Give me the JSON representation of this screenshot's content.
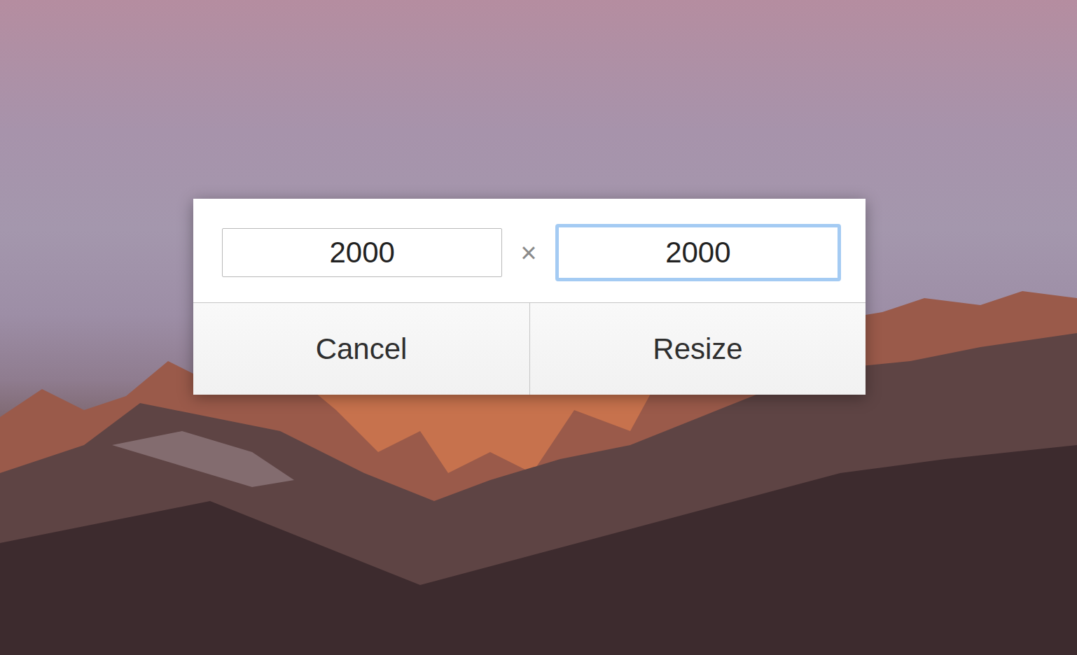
{
  "dialog": {
    "fields": [
      {
        "value": "2000",
        "focused": false
      },
      {
        "value": "2000",
        "focused": true
      }
    ],
    "separator": "×",
    "buttons": [
      {
        "label": "Cancel"
      },
      {
        "label": "Resize"
      }
    ]
  }
}
